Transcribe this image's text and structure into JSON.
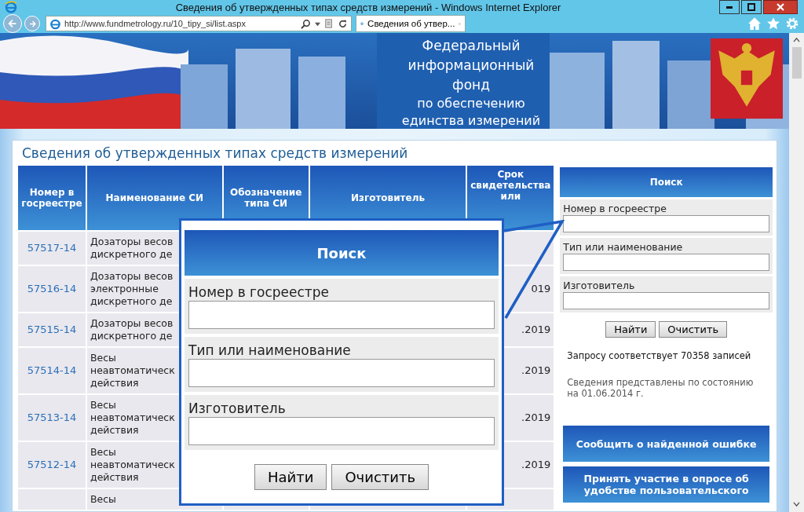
{
  "window": {
    "title": "Сведения об утвержденных типах средств измерений - Windows Internet Explorer"
  },
  "browser": {
    "url": "http://www.fundmetrology.ru/10_tipy_si/list.aspx",
    "tabs": [
      {
        "label": "Сведения об утвер...",
        "selected": true
      }
    ]
  },
  "header": {
    "lines": [
      "Федеральный",
      "информационный",
      "фонд",
      "по обеспечению",
      "единства измерений"
    ]
  },
  "page_title": "Сведения об утвержденных типах средств измерений",
  "table": {
    "columns": [
      "Номер в госреестре",
      "Наименование СИ",
      "Обозначение типа СИ",
      "Изготовитель",
      "Срок свидетельства или"
    ],
    "rows": [
      {
        "number": "57517-14",
        "name": "Дозаторы весов\nдискретного де",
        "column_5": ""
      },
      {
        "number": "57516-14",
        "name": "Дозаторы весов\nэлектронные\nдискретного де",
        "column_5": "019"
      },
      {
        "number": "57515-14",
        "name": "Дозаторы весов\nдискретного де",
        "column_5": ".2019"
      },
      {
        "number": "57514-14",
        "name": "Весы\nнеавтоматическ\nдействия",
        "column_5": ".2019"
      },
      {
        "number": "57513-14",
        "name": "Весы\nнеавтоматическ\nдействия",
        "column_5": ".2019"
      },
      {
        "number": "57512-14",
        "name": "Весы\nнеавтоматическ\nдействия",
        "column_5": ".2019"
      },
      {
        "number": "",
        "name": "Весы",
        "column_5": ""
      }
    ]
  },
  "search_panel": {
    "title": "Поиск",
    "fields": [
      {
        "label": "Номер в госреестре"
      },
      {
        "label": "Тип или наименование"
      },
      {
        "label": "Изготовитель"
      }
    ],
    "buttons": [
      "Найти",
      "Очистить"
    ],
    "result_count": "Запросу соответствует 70358 записей",
    "data_date": "Сведения представлены по состоянию на 01.06.2014 г.",
    "links": [
      "Сообщить о найденной ошибке",
      "Принять участие в опросе об удобстве пользовательского"
    ]
  },
  "callout": {
    "title": "Поиск",
    "fields": [
      {
        "label": "Номер в госреестре"
      },
      {
        "label": "Тип или наименование"
      },
      {
        "label": "Изготовитель"
      }
    ],
    "buttons": [
      "Найти",
      "Очистить"
    ]
  }
}
